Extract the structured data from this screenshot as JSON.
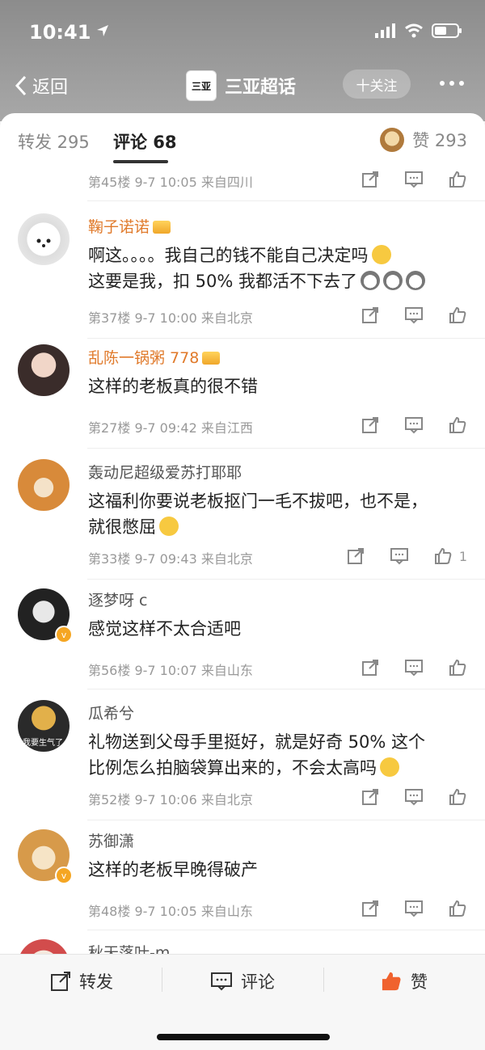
{
  "status": {
    "time": "10:41"
  },
  "nav": {
    "back": "返回",
    "title": "三亚超话",
    "logo_text": "三亚",
    "follow": "十关注"
  },
  "tabs": {
    "repost": "转发 295",
    "comment": "评论 68",
    "likes": "赞 293"
  },
  "comments": [
    {
      "name": "",
      "text": "",
      "meta": "第45楼  9-7 10:05  来自四川",
      "likes": ""
    },
    {
      "name": "鞠子诺诺",
      "text": "啊这。。。。我自己的钱不能自己决定吗",
      "text2": "这要是我，扣 50% 我都活不下去了",
      "meta": "第37楼  9-7 10:00  来自北京",
      "likes": ""
    },
    {
      "name": "乱陈一锅粥 778",
      "text": "这样的老板真的很不错",
      "meta": "第27楼  9-7 09:42  来自江西",
      "likes": ""
    },
    {
      "name": "轰动尼超级爱苏打耶耶",
      "text": "这福利你要说老板抠门一毛不拔吧，也不是，",
      "text2": "就很憋屈",
      "meta": "第33楼  9-7 09:43  来自北京",
      "likes": "1"
    },
    {
      "name": "逐梦呀 c",
      "text": "感觉这样不太合适吧",
      "meta": "第56楼  9-7 10:07  来自山东",
      "likes": ""
    },
    {
      "name": "瓜希兮",
      "text": "礼物送到父母手里挺好，就是好奇 50% 这个",
      "text2": "比例怎么拍脑袋算出来的，不会太高吗",
      "meta": "第52楼  9-7 10:06  来自北京",
      "likes": "",
      "avatar_caption": "我要生气了"
    },
    {
      "name": "苏御潇",
      "text": "这样的老板早晚得破产",
      "meta": "第48楼  9-7 10:05  来自山东",
      "likes": ""
    },
    {
      "name": "秋天落叶-m",
      "text": "",
      "meta": "",
      "likes": ""
    }
  ],
  "bottom": {
    "repost": "转发",
    "comment": "评论",
    "like": "赞"
  },
  "colors": {
    "accent": "#e07a2b",
    "like_active": "#f0622e"
  }
}
